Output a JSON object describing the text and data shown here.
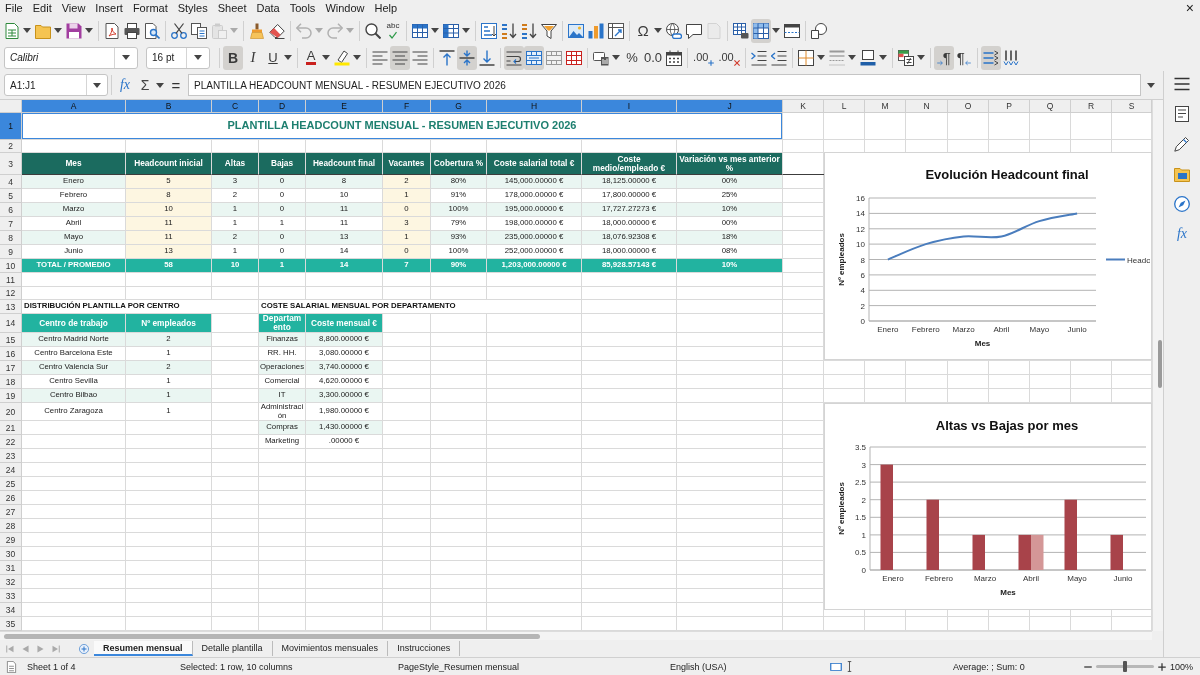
{
  "menu": {
    "items": [
      "File",
      "Edit",
      "View",
      "Insert",
      "Format",
      "Styles",
      "Sheet",
      "Data",
      "Tools",
      "Window",
      "Help"
    ],
    "close_glyph": "×"
  },
  "standard_toolbar": {
    "paste": {
      "disabled": true
    },
    "undo": {
      "disabled": true
    },
    "redo": {
      "disabled": true
    },
    "spelling": {
      "glyph": "abc"
    },
    "special_character": {
      "glyph": "Ω"
    },
    "headers_footers": {
      "disabled": true
    },
    "freeze": {
      "on": true
    }
  },
  "formatting_toolbar": {
    "font_name": "Calibri",
    "font_size": "16 pt",
    "bold": {
      "glyph": "B",
      "on": true
    },
    "italic": {
      "glyph": "I",
      "on": false
    },
    "underline": {
      "glyph": "U",
      "on": false
    },
    "font_color": {
      "glyph": "A"
    },
    "align_left": {
      "on": false
    },
    "align_center": {
      "on": true
    },
    "align_right": {
      "on": false
    },
    "align_top": {
      "on": false
    },
    "align_middle": {
      "on": true
    },
    "align_bottom": {
      "on": false
    },
    "wrap_text": {
      "on": true
    },
    "merge_and_center": {
      "on": true
    },
    "percent": {
      "glyph": "%"
    },
    "standard_format": {
      "glyph": "0.0"
    },
    "add_decimal": {
      "glyph": ".00"
    },
    "delete_decimal": {
      "glyph": ".00"
    },
    "left_to_right": {
      "glyph": "¶",
      "on": true
    },
    "right_to_left": {
      "glyph": "¶",
      "on": false
    },
    "text_horizontal": {
      "on": true
    },
    "text_vertical": {
      "on": false
    }
  },
  "formula_bar": {
    "name_box": "A1:J1",
    "function_wizard": "fx",
    "sum": "Σ",
    "equals": "=",
    "content": "PLANTILLA HEADCOUNT MENSUAL - RESUMEN EJECUTIVO 2026"
  },
  "sidebar": {
    "functions": "fx"
  },
  "sheet": {
    "column_headers": [
      {
        "label": "A",
        "selected": true
      },
      {
        "label": "B",
        "selected": true
      },
      {
        "label": "C",
        "selected": true
      },
      {
        "label": "D",
        "selected": true
      },
      {
        "label": "E",
        "selected": true
      },
      {
        "label": "F",
        "selected": true
      },
      {
        "label": "G",
        "selected": true
      },
      {
        "label": "H",
        "selected": true
      },
      {
        "label": "I",
        "selected": true
      },
      {
        "label": "J",
        "selected": true
      },
      {
        "label": "K",
        "selected": false
      },
      {
        "label": "L",
        "selected": false
      },
      {
        "label": "M",
        "selected": false
      },
      {
        "label": "N",
        "selected": false
      },
      {
        "label": "O",
        "selected": false
      },
      {
        "label": "P",
        "selected": false
      },
      {
        "label": "Q",
        "selected": false
      },
      {
        "label": "R",
        "selected": false
      },
      {
        "label": "S",
        "selected": false
      }
    ],
    "row_headers": [
      {
        "label": "1",
        "selected": true
      },
      {
        "label": "2",
        "selected": false
      },
      {
        "label": "3",
        "selected": false
      },
      {
        "label": "4",
        "selected": false
      },
      {
        "label": "5",
        "selected": false
      },
      {
        "label": "6",
        "selected": false
      },
      {
        "label": "7",
        "selected": false
      },
      {
        "label": "8",
        "selected": false
      },
      {
        "label": "9",
        "selected": false
      },
      {
        "label": "10",
        "selected": false
      },
      {
        "label": "11",
        "selected": false
      },
      {
        "label": "12",
        "selected": false
      },
      {
        "label": "13",
        "selected": false
      },
      {
        "label": "14",
        "selected": false
      },
      {
        "label": "15",
        "selected": false
      },
      {
        "label": "16",
        "selected": false
      },
      {
        "label": "17",
        "selected": false
      },
      {
        "label": "18",
        "selected": false
      },
      {
        "label": "19",
        "selected": false
      },
      {
        "label": "20",
        "selected": false
      },
      {
        "label": "21",
        "selected": false
      },
      {
        "label": "22",
        "selected": false
      },
      {
        "label": "23",
        "selected": false
      },
      {
        "label": "24",
        "selected": false
      },
      {
        "label": "25",
        "selected": false
      },
      {
        "label": "26",
        "selected": false
      },
      {
        "label": "27",
        "selected": false
      },
      {
        "label": "28",
        "selected": false
      },
      {
        "label": "29",
        "selected": false
      },
      {
        "label": "30",
        "selected": false
      },
      {
        "label": "31",
        "selected": false
      },
      {
        "label": "32",
        "selected": false
      },
      {
        "label": "33",
        "selected": false
      },
      {
        "label": "34",
        "selected": false
      },
      {
        "label": "35",
        "selected": false
      }
    ],
    "title": {
      "text": "PLANTILLA HEADCOUNT MENSUAL - RESUMEN EJECUTIVO 2026",
      "selected": true
    },
    "summary_table": {
      "columns": [
        {
          "label": "Mes",
          "kind": "text"
        },
        {
          "label": "Headcount inicial",
          "kind": "input"
        },
        {
          "label": "Altas",
          "kind": "calc"
        },
        {
          "label": "Bajas",
          "kind": "calc"
        },
        {
          "label": "Headcount final",
          "kind": "calc"
        },
        {
          "label": "Vacantes",
          "kind": "input"
        },
        {
          "label": "Cobertura %",
          "kind": "calc"
        },
        {
          "label": "Coste salarial total €",
          "kind": "calc"
        },
        {
          "label": "Coste medio/empleado €",
          "kind": "calc"
        },
        {
          "label": "Variación vs mes anterior %",
          "kind": "calc"
        }
      ],
      "rows": [
        [
          "Enero",
          "5",
          "3",
          "0",
          "8",
          "2",
          "80%",
          "145,000.00000 €",
          "18,125.00000 €",
          "00%"
        ],
        [
          "Febrero",
          "8",
          "2",
          "0",
          "10",
          "1",
          "91%",
          "178,000.00000 €",
          "17,800.00000 €",
          "25%"
        ],
        [
          "Marzo",
          "10",
          "1",
          "0",
          "11",
          "0",
          "100%",
          "195,000.00000 €",
          "17,727.27273 €",
          "10%"
        ],
        [
          "Abril",
          "11",
          "1",
          "1",
          "11",
          "3",
          "79%",
          "198,000.00000 €",
          "18,000.00000 €",
          "00%"
        ],
        [
          "Mayo",
          "11",
          "2",
          "0",
          "13",
          "1",
          "93%",
          "235,000.00000 €",
          "18,076.92308 €",
          "18%"
        ],
        [
          "Junio",
          "13",
          "1",
          "0",
          "14",
          "0",
          "100%",
          "252,000.00000 €",
          "18,000.00000 €",
          "08%"
        ]
      ],
      "total": [
        "TOTAL / PROMEDIO",
        "58",
        "10",
        "1",
        "14",
        "7",
        "90%",
        "1,203,000.00000 €",
        "85,928.57143 €",
        "10%"
      ]
    },
    "center_table": {
      "title": "DISTRIBUCIÓN PLANTILLA POR CENTRO",
      "columns": [
        "Centro de trabajo",
        "Nº empleados"
      ],
      "rows": [
        [
          "Centro Madrid Norte",
          "2"
        ],
        [
          "Centro Barcelona Este",
          "1"
        ],
        [
          "Centro Valencia Sur",
          "2"
        ],
        [
          "Centro Sevilla",
          "1"
        ],
        [
          "Centro Bilbao",
          "1"
        ],
        [
          "Centro Zaragoza",
          "1"
        ]
      ]
    },
    "department_table": {
      "title": "COSTE SALARIAL MENSUAL POR DEPARTAMENTO",
      "columns": [
        "Departamento",
        "Coste mensual €"
      ],
      "rows": [
        [
          "Finanzas",
          "8,800.00000 €"
        ],
        [
          "RR. HH.",
          "3,080.00000 €"
        ],
        [
          "Operaciones",
          "3,740.00000 €"
        ],
        [
          "Comercial",
          "4,620.00000 €"
        ],
        [
          "IT",
          "3,300.00000 €"
        ],
        [
          "Administración",
          "1,980.00000 €"
        ],
        [
          "Compras",
          "1,430.00000 €"
        ],
        [
          "Marketing",
          ".00000 €"
        ]
      ]
    }
  },
  "charts": [
    {
      "chart_data": {
        "type": "line",
        "title": "Evolución Headcount final",
        "xlabel": "Mes",
        "ylabel": "Nº empleados",
        "categories": [
          "Enero",
          "Febrero",
          "Marzo",
          "Abril",
          "Mayo",
          "Junio"
        ],
        "series": [
          {
            "name": "Headc",
            "color": "#4a7dbd",
            "values": [
              8,
              10,
              11,
              11,
              13,
              14
            ]
          }
        ],
        "ylim": [
          0,
          16
        ],
        "yticks": [
          0,
          2,
          4,
          6,
          8,
          10,
          12,
          14,
          16
        ],
        "grid": true
      }
    },
    {
      "chart_data": {
        "type": "bar",
        "title": "Altas vs Bajas por mes",
        "xlabel": "Mes",
        "ylabel": "Nº empleados",
        "categories": [
          "Enero",
          "Febrero",
          "Marzo",
          "Abril",
          "Mayo",
          "Junio"
        ],
        "series": [
          {
            "color": "#a8434a",
            "values": [
              3,
              2,
              1,
              1,
              2,
              1
            ]
          },
          {
            "color": "#d49797",
            "values": [
              0,
              0,
              0,
              1,
              0,
              0
            ]
          }
        ],
        "ylim": [
          0,
          3.5
        ],
        "yticks": [
          0,
          0.5,
          1,
          1.5,
          2,
          2.5,
          3,
          3.5
        ],
        "grid": true
      }
    }
  ],
  "sheet_tabs": [
    {
      "label": "Resumen mensual",
      "selected": true
    },
    {
      "label": "Detalle plantilla",
      "selected": false
    },
    {
      "label": "Movimientos mensuales",
      "selected": false
    },
    {
      "label": "Instrucciones",
      "selected": false
    }
  ],
  "status_bar": {
    "sheet": "Sheet 1 of 4",
    "selection": "Selected: 1 row, 10 columns",
    "page_style": "PageStyle_Resumen mensual",
    "language": "English (USA)",
    "summary": "Average: ; Sum: 0",
    "zoom": {
      "level": 0.5
    },
    "zoom_percent": "100%"
  }
}
